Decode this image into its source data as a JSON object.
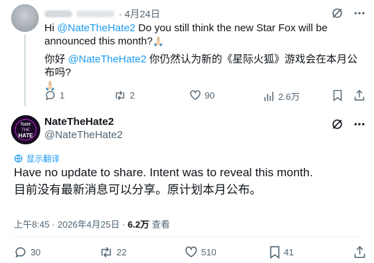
{
  "parent_post": {
    "date": "4月24日",
    "reply_prefix": "Hi ",
    "mention": "@NateTheHate2",
    "reply_text": " Do you still think the new Star Fox will be announced this month?",
    "emoji": "🙏🏻",
    "cn_prefix": "你好 ",
    "cn_mention": "@NateTheHate2",
    "cn_text": " 你仍然认为新的《星际火狐》游戏会在本月公布吗?",
    "stats": {
      "replies": "1",
      "reposts": "2",
      "likes": "90",
      "views": "2.6万"
    }
  },
  "main_post": {
    "display_name": "NateTheHate2",
    "handle": "@NateTheHate2",
    "translate_label": "显示翻译",
    "text_en": "Have no update to share. Intent was to reveal this month.",
    "text_cn": "目前没有最新消息可以分享。原计划本月公布。",
    "time": "上午8:45 · 2026年4月25日 · ",
    "views": "6.2万",
    "views_label": " 查看",
    "stats": {
      "replies": "30",
      "reposts": "22",
      "likes": "510",
      "bookmarks": "41"
    }
  },
  "avatar_text": [
    "Nate",
    "THE",
    "HATE"
  ],
  "colors": {
    "accent": "#1d9bf0",
    "secondary_text": "#536471",
    "avatar_magenta": "#d22bd6"
  }
}
